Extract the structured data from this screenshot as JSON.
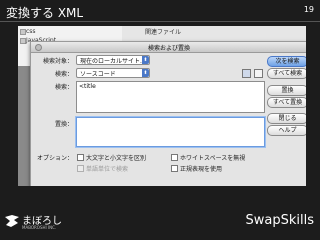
{
  "slide": {
    "title": "変換する XML",
    "page_number": "19"
  },
  "background_window": {
    "list_items": [
      "css",
      "JavaScript"
    ],
    "panel_label": "関連ファイル"
  },
  "dialog": {
    "title": "検索および置換",
    "search_target_label": "検索対象：",
    "search_target_value": "現在のローカルサイト...",
    "search_type_label": "検索：",
    "search_type_value": "ソースコード",
    "find_label": "検索：",
    "find_text": "<title",
    "replace_label": "置換：",
    "replace_text": "",
    "options_label": "オプション：",
    "options": [
      {
        "label": "大文字と小文字を区別",
        "checked": false,
        "disabled": false
      },
      {
        "label": "ホワイトスペースを無視",
        "checked": false,
        "disabled": false
      },
      {
        "label": "単語単位で検索",
        "checked": false,
        "disabled": true
      },
      {
        "label": "正規表現を使用",
        "checked": false,
        "disabled": false
      }
    ],
    "buttons": {
      "find_next": "次を検索",
      "find_all": "すべて検索",
      "replace": "置換",
      "replace_all": "すべて置換",
      "close": "閉じる",
      "help": "ヘルプ"
    }
  },
  "footer": {
    "left_logo_text": "まぼろし",
    "left_logo_subtext": "MABOROSHI INC.",
    "right_brand": "SwapSkills"
  },
  "colors": {
    "slide_background": "#1c1c1c",
    "dialog_background": "#e4e4e4",
    "default_button": "#6ea1e6",
    "select_arrow": "#4a78c8"
  }
}
